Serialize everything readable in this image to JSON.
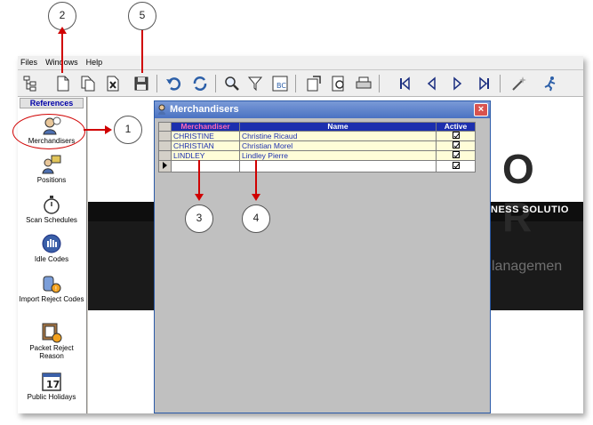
{
  "menu": {
    "items": [
      "Files",
      "Windows",
      "Help"
    ]
  },
  "toolbar": {
    "buttons": [
      "tree-icon",
      "new-icon",
      "copy-icon",
      "delete-icon",
      "save-icon",
      "undo-icon",
      "refresh-icon",
      "search-icon",
      "filter-icon",
      "sort-icon",
      "export-icon",
      "preview-icon",
      "print-icon",
      "first-icon",
      "prev-icon",
      "next-icon",
      "last-icon",
      "wand-icon",
      "exit-icon"
    ]
  },
  "sidebar": {
    "header": "References",
    "items": [
      {
        "label": "Merchandisers",
        "icon": "merchandisers-icon"
      },
      {
        "label": "Positions",
        "icon": "positions-icon"
      },
      {
        "label": "Scan Schedules",
        "icon": "stopwatch-icon"
      },
      {
        "label": "Idle Codes",
        "icon": "idle-icon"
      },
      {
        "label": "Import Reject Codes",
        "icon": "import-reject-icon"
      },
      {
        "label": "Packet Reject Reason",
        "icon": "packet-reject-icon"
      },
      {
        "label": "Public Holidays",
        "icon": "calendar-icon"
      }
    ],
    "calendar_day": "17"
  },
  "background": {
    "big_letters": "O R",
    "band_text": "NESS SOLUTIO",
    "sub_text": "lanagemen"
  },
  "dialog": {
    "title": "Merchandisers",
    "close_label": "×",
    "columns": [
      "Merchandiser",
      "Name",
      "Active"
    ],
    "rows": [
      {
        "code": "CHRISTINE",
        "name": "Christine Ricaud",
        "active": true
      },
      {
        "code": "CHRISTIAN",
        "name": "Christian Morel",
        "active": true
      },
      {
        "code": "LINDLEY",
        "name": "Lindley Pierre",
        "active": true
      },
      {
        "code": "",
        "name": "",
        "active": true
      }
    ]
  },
  "callouts": [
    "1",
    "2",
    "3",
    "4",
    "5"
  ],
  "colors": {
    "annotation": "#d00000",
    "grid_header": "#1c2fae",
    "row_bg": "#fffdd8",
    "title_bar": "#5a7fc8"
  }
}
